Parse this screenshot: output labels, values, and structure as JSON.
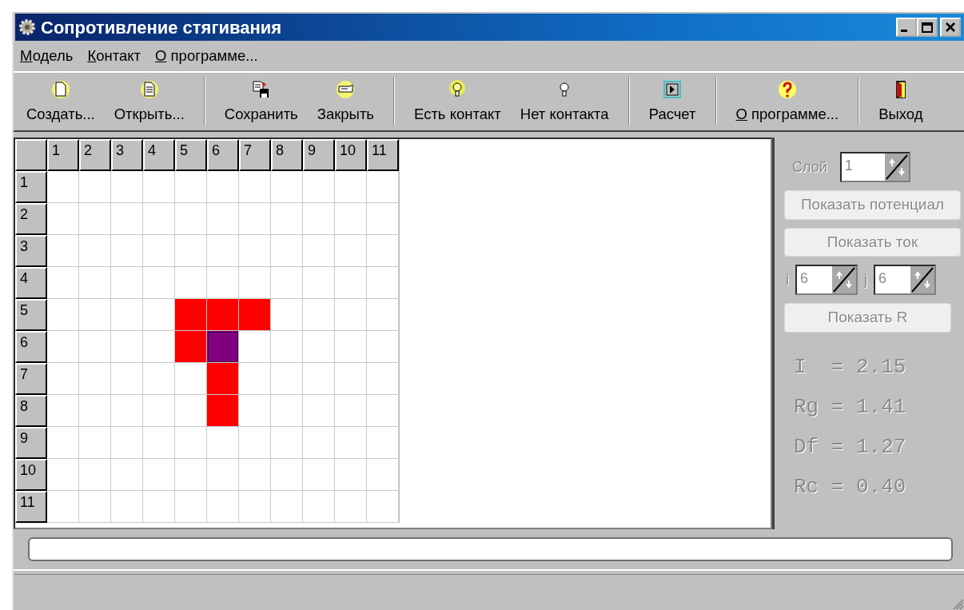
{
  "window": {
    "title": "Сопротивление стягивания"
  },
  "menu": [
    {
      "label": "Модель",
      "hotkey": true
    },
    {
      "label": "Контакт",
      "hotkey": true
    },
    {
      "label": "О программе...",
      "hotkey": true
    }
  ],
  "toolbar": [
    {
      "items": [
        {
          "label": "Создать...",
          "hotkey": false
        },
        {
          "label": "Открыть...",
          "hotkey": false
        }
      ]
    },
    {
      "items": [
        {
          "label": "Сохранить",
          "hotkey": false
        },
        {
          "label": "Закрыть",
          "hotkey": false
        }
      ]
    },
    {
      "items": [
        {
          "label": "Есть контакт",
          "hotkey": false
        },
        {
          "label": "Нет контакта",
          "hotkey": false
        }
      ]
    },
    {
      "items": [
        {
          "label": "Расчет",
          "hotkey": false
        }
      ]
    },
    {
      "items": [
        {
          "label": "О программе...",
          "hotkey": true
        }
      ]
    },
    {
      "items": [
        {
          "label": "Выход",
          "hotkey": false
        }
      ]
    }
  ],
  "grid": {
    "columns": [
      "1",
      "2",
      "3",
      "4",
      "5",
      "6",
      "7",
      "8",
      "9",
      "10",
      "11"
    ],
    "rows": [
      {
        "label": "1",
        "cells": [
          {
            "kind": "empty"
          },
          {
            "kind": "empty"
          },
          {
            "kind": "empty"
          },
          {
            "kind": "empty"
          },
          {
            "kind": "empty"
          },
          {
            "kind": "empty"
          },
          {
            "kind": "empty"
          },
          {
            "kind": "empty"
          },
          {
            "kind": "empty"
          },
          {
            "kind": "empty"
          },
          {
            "kind": "empty"
          }
        ]
      },
      {
        "label": "2",
        "cells": [
          {
            "kind": "empty"
          },
          {
            "kind": "empty"
          },
          {
            "kind": "empty"
          },
          {
            "kind": "empty"
          },
          {
            "kind": "empty"
          },
          {
            "kind": "empty"
          },
          {
            "kind": "empty"
          },
          {
            "kind": "empty"
          },
          {
            "kind": "empty"
          },
          {
            "kind": "empty"
          },
          {
            "kind": "empty"
          }
        ]
      },
      {
        "label": "3",
        "cells": [
          {
            "kind": "empty"
          },
          {
            "kind": "empty"
          },
          {
            "kind": "empty"
          },
          {
            "kind": "empty"
          },
          {
            "kind": "empty"
          },
          {
            "kind": "empty"
          },
          {
            "kind": "empty"
          },
          {
            "kind": "empty"
          },
          {
            "kind": "empty"
          },
          {
            "kind": "empty"
          },
          {
            "kind": "empty"
          }
        ]
      },
      {
        "label": "4",
        "cells": [
          {
            "kind": "empty"
          },
          {
            "kind": "empty"
          },
          {
            "kind": "empty"
          },
          {
            "kind": "empty"
          },
          {
            "kind": "empty"
          },
          {
            "kind": "empty"
          },
          {
            "kind": "empty"
          },
          {
            "kind": "empty"
          },
          {
            "kind": "empty"
          },
          {
            "kind": "empty"
          },
          {
            "kind": "empty"
          }
        ]
      },
      {
        "label": "5",
        "cells": [
          {
            "kind": "empty"
          },
          {
            "kind": "empty"
          },
          {
            "kind": "empty"
          },
          {
            "kind": "empty"
          },
          {
            "kind": "filled"
          },
          {
            "kind": "filled"
          },
          {
            "kind": "filled"
          },
          {
            "kind": "empty"
          },
          {
            "kind": "empty"
          },
          {
            "kind": "empty"
          },
          {
            "kind": "empty"
          }
        ]
      },
      {
        "label": "6",
        "cells": [
          {
            "kind": "empty"
          },
          {
            "kind": "empty"
          },
          {
            "kind": "empty"
          },
          {
            "kind": "empty"
          },
          {
            "kind": "filled"
          },
          {
            "kind": "contact"
          },
          {
            "kind": "empty"
          },
          {
            "kind": "empty"
          },
          {
            "kind": "empty"
          },
          {
            "kind": "empty"
          },
          {
            "kind": "empty"
          }
        ]
      },
      {
        "label": "7",
        "cells": [
          {
            "kind": "empty"
          },
          {
            "kind": "empty"
          },
          {
            "kind": "empty"
          },
          {
            "kind": "empty"
          },
          {
            "kind": "empty"
          },
          {
            "kind": "filled"
          },
          {
            "kind": "empty"
          },
          {
            "kind": "empty"
          },
          {
            "kind": "empty"
          },
          {
            "kind": "empty"
          },
          {
            "kind": "empty"
          }
        ]
      },
      {
        "label": "8",
        "cells": [
          {
            "kind": "empty"
          },
          {
            "kind": "empty"
          },
          {
            "kind": "empty"
          },
          {
            "kind": "empty"
          },
          {
            "kind": "empty"
          },
          {
            "kind": "filled"
          },
          {
            "kind": "empty"
          },
          {
            "kind": "empty"
          },
          {
            "kind": "empty"
          },
          {
            "kind": "empty"
          },
          {
            "kind": "empty"
          }
        ]
      },
      {
        "label": "9",
        "cells": [
          {
            "kind": "empty"
          },
          {
            "kind": "empty"
          },
          {
            "kind": "empty"
          },
          {
            "kind": "empty"
          },
          {
            "kind": "empty"
          },
          {
            "kind": "empty"
          },
          {
            "kind": "empty"
          },
          {
            "kind": "empty"
          },
          {
            "kind": "empty"
          },
          {
            "kind": "empty"
          },
          {
            "kind": "empty"
          }
        ]
      },
      {
        "label": "10",
        "cells": [
          {
            "kind": "empty"
          },
          {
            "kind": "empty"
          },
          {
            "kind": "empty"
          },
          {
            "kind": "empty"
          },
          {
            "kind": "empty"
          },
          {
            "kind": "empty"
          },
          {
            "kind": "empty"
          },
          {
            "kind": "empty"
          },
          {
            "kind": "empty"
          },
          {
            "kind": "empty"
          },
          {
            "kind": "empty"
          }
        ]
      },
      {
        "label": "11",
        "cells": [
          {
            "kind": "empty"
          },
          {
            "kind": "empty"
          },
          {
            "kind": "empty"
          },
          {
            "kind": "empty"
          },
          {
            "kind": "empty"
          },
          {
            "kind": "empty"
          },
          {
            "kind": "empty"
          },
          {
            "kind": "empty"
          },
          {
            "kind": "empty"
          },
          {
            "kind": "empty"
          },
          {
            "kind": "empty"
          }
        ]
      }
    ]
  },
  "panel": {
    "layer": {
      "label": "Слой",
      "value": "1",
      "disabled": true
    },
    "buttons": [
      {
        "label": "Показать потенциал",
        "disabled": true
      },
      {
        "label": "Показать ток",
        "disabled": true
      }
    ],
    "coords": [
      {
        "label": "i",
        "value": "6",
        "disabled": true
      },
      {
        "label": "j",
        "value": "6",
        "disabled": true
      }
    ],
    "r_button": {
      "label": "Показать R",
      "disabled": true
    },
    "results": [
      "I  = 2.15",
      "Rg = 1.41",
      "Df = 1.27",
      "Rc = 0.40"
    ]
  },
  "progress": {
    "level": 0
  }
}
